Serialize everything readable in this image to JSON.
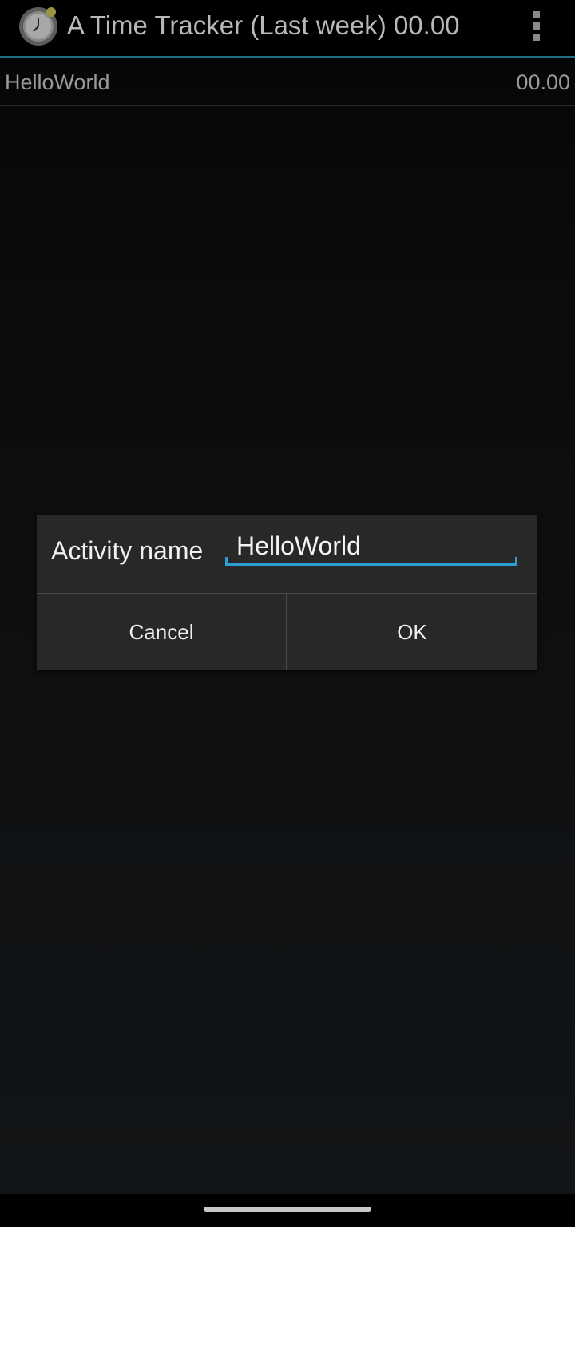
{
  "app": {
    "title": "A Time Tracker (Last week) 00.00",
    "icon": "clock-icon",
    "menu_icon": "overflow-menu-icon"
  },
  "activities": [
    {
      "name": "HelloWorld",
      "time": "00.00"
    }
  ],
  "dialog": {
    "label": "Activity name",
    "input_value": "HelloWorld",
    "cancel_label": "Cancel",
    "ok_label": "OK"
  },
  "colors": {
    "accent": "#2a9fd0",
    "action_bar_divider": "#1f6e84",
    "dialog_bg": "#282828"
  }
}
